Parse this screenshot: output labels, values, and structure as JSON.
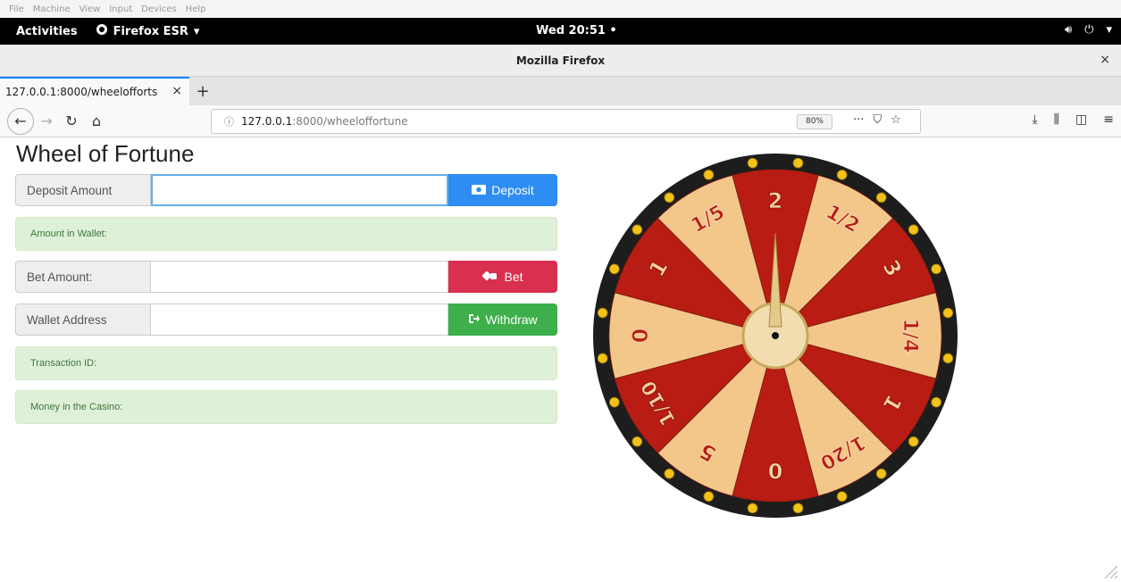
{
  "vm_menu": [
    "File",
    "Machine",
    "View",
    "Input",
    "Devices",
    "Help"
  ],
  "gnome": {
    "activities": "Activities",
    "app_menu": "Firefox ESR",
    "clock": "Wed 20:51"
  },
  "window": {
    "title": "Mozilla Firefox",
    "close": "×"
  },
  "tab": {
    "label": "127.0.0.1:8000/wheelofforts",
    "close": "×",
    "new_tab": "+"
  },
  "url": {
    "host": "127.0.0.1",
    "path": ":8000/wheeloffortune",
    "zoom": "80%",
    "more": "···"
  },
  "page": {
    "title": "Wheel of Fortune",
    "deposit": {
      "label": "Deposit Amount",
      "value": "",
      "button": "Deposit"
    },
    "wallet_amount": "Amount in Wallet:",
    "bet": {
      "label": "Bet Amount:",
      "value": "",
      "button": "Bet"
    },
    "withdraw": {
      "label": "Wallet Address",
      "value": "",
      "button": "Withdraw"
    },
    "transaction_id": "Transaction ID:",
    "casino_money": "Money in the Casino:"
  },
  "wheel": {
    "segments": [
      "2",
      "1/2",
      "3",
      "1/4",
      "1",
      "1/20",
      "0",
      "5",
      "1/10",
      "0",
      "1",
      "1/5"
    ],
    "colors": {
      "red": "#b81c12",
      "cream": "#f3c78a",
      "rim": "#1d1d1d",
      "bulb": "#f2c21a"
    }
  },
  "colors": {
    "deposit_btn": "#2e8df2",
    "bet_btn": "#d9304f",
    "withdraw_btn": "#3daf4b",
    "alert_bg": "#dff0d8"
  }
}
